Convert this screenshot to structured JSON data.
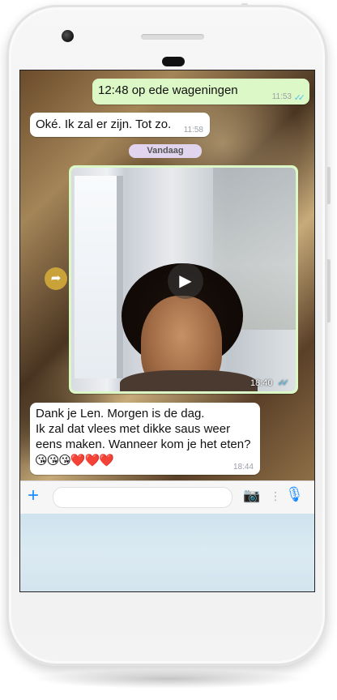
{
  "chat": {
    "messages": [
      {
        "direction": "outgoing",
        "text": "12:48 op ede wageningen",
        "time": "11:53",
        "status": "read"
      },
      {
        "direction": "incoming",
        "text": "Oké. Ik zal er zijn. Tot zo.",
        "time": "11:58"
      }
    ],
    "date_divider": "Vandaag",
    "video_message": {
      "direction": "outgoing",
      "time": "18:40",
      "status": "read"
    },
    "last_message": {
      "direction": "incoming",
      "lines": [
        "Dank je Len. Morgen is de dag.",
        "Ik zal dat vlees met dikke saus weer",
        "eens maken. Wanneer kom je het eten?"
      ],
      "emoji": "😘😘😘❤️❤️❤️",
      "time": "18:44"
    }
  },
  "icons": {
    "read_receipt": "✓✓",
    "play": "▶",
    "forward": "➦",
    "plus": "+",
    "camera": "📷",
    "mic": "🎙"
  },
  "input_bar": {
    "placeholder": "",
    "separator": "⋮"
  },
  "colors": {
    "outgoing_bubble": "#dcf8c6",
    "incoming_bubble": "#ffffff",
    "accent": "#1a8cff",
    "read_ticks": "#4fc3f7"
  }
}
